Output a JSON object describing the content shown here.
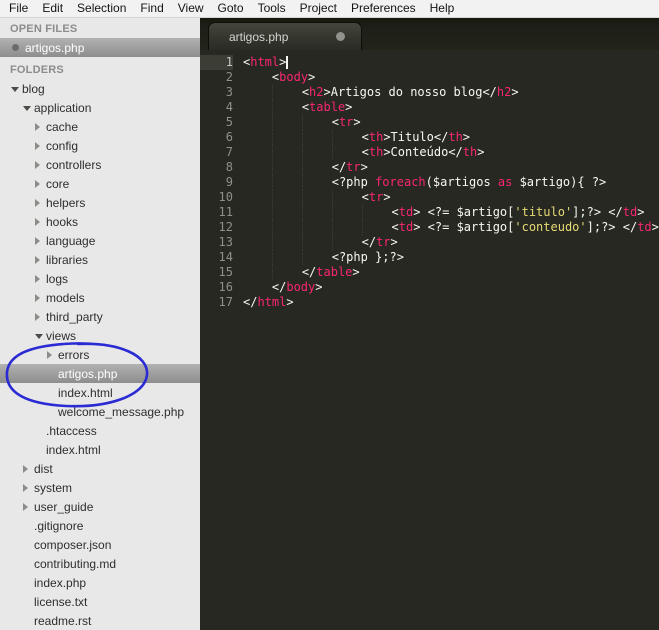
{
  "menu": {
    "items": [
      "File",
      "Edit",
      "Selection",
      "Find",
      "View",
      "Goto",
      "Tools",
      "Project",
      "Preferences",
      "Help"
    ]
  },
  "sidebar": {
    "open_files_header": "OPEN FILES",
    "open_files": [
      {
        "label": "artigos.php",
        "selected": true,
        "modified": true
      }
    ],
    "folders_header": "FOLDERS",
    "annotation": {
      "shape": "hand-drawn-ellipse",
      "color": "#2b2bd4",
      "around": [
        "views",
        "errors",
        "artigos.php"
      ]
    },
    "tree": [
      {
        "label": "blog",
        "type": "folder",
        "state": "expanded",
        "level": 0
      },
      {
        "label": "application",
        "type": "folder",
        "state": "expanded",
        "level": 1
      },
      {
        "label": "cache",
        "type": "folder",
        "state": "collapsed",
        "level": 2
      },
      {
        "label": "config",
        "type": "folder",
        "state": "collapsed",
        "level": 2
      },
      {
        "label": "controllers",
        "type": "folder",
        "state": "collapsed",
        "level": 2
      },
      {
        "label": "core",
        "type": "folder",
        "state": "collapsed",
        "level": 2
      },
      {
        "label": "helpers",
        "type": "folder",
        "state": "collapsed",
        "level": 2
      },
      {
        "label": "hooks",
        "type": "folder",
        "state": "collapsed",
        "level": 2
      },
      {
        "label": "language",
        "type": "folder",
        "state": "collapsed",
        "level": 2
      },
      {
        "label": "libraries",
        "type": "folder",
        "state": "collapsed",
        "level": 2
      },
      {
        "label": "logs",
        "type": "folder",
        "state": "collapsed",
        "level": 2
      },
      {
        "label": "models",
        "type": "folder",
        "state": "collapsed",
        "level": 2
      },
      {
        "label": "third_party",
        "type": "folder",
        "state": "collapsed",
        "level": 2
      },
      {
        "label": "views",
        "type": "folder",
        "state": "expanded",
        "level": 2
      },
      {
        "label": "errors",
        "type": "folder",
        "state": "collapsed",
        "level": 3
      },
      {
        "label": "artigos.php",
        "type": "file",
        "level": 3,
        "selected": true
      },
      {
        "label": "index.html",
        "type": "file",
        "level": 3
      },
      {
        "label": "welcome_message.php",
        "type": "file",
        "level": 3
      },
      {
        "label": ".htaccess",
        "type": "file",
        "level": 2
      },
      {
        "label": "index.html",
        "type": "file",
        "level": 2
      },
      {
        "label": "dist",
        "type": "folder",
        "state": "collapsed",
        "level": 1
      },
      {
        "label": "system",
        "type": "folder",
        "state": "collapsed",
        "level": 1
      },
      {
        "label": "user_guide",
        "type": "folder",
        "state": "collapsed",
        "level": 1
      },
      {
        "label": ".gitignore",
        "type": "file",
        "level": 1
      },
      {
        "label": "composer.json",
        "type": "file",
        "level": 1
      },
      {
        "label": "contributing.md",
        "type": "file",
        "level": 1
      },
      {
        "label": "index.php",
        "type": "file",
        "level": 1
      },
      {
        "label": "license.txt",
        "type": "file",
        "level": 1
      },
      {
        "label": "readme.rst",
        "type": "file",
        "level": 1
      }
    ]
  },
  "editor": {
    "tab": {
      "label": "artigos.php",
      "modified": true
    },
    "colors": {
      "bg": "#272822",
      "plain": "#f8f8f2",
      "tag": "#f92672",
      "string": "#e6db74",
      "line_number": "#8f908a"
    },
    "lines": [
      {
        "num": 1,
        "indent": 0,
        "cursor": true,
        "tokens": [
          [
            "p",
            "<"
          ],
          [
            "t",
            "html"
          ],
          [
            "p",
            ">"
          ]
        ]
      },
      {
        "num": 2,
        "indent": 4,
        "tokens": [
          [
            "p",
            "<"
          ],
          [
            "t",
            "body"
          ],
          [
            "p",
            ">"
          ]
        ]
      },
      {
        "num": 3,
        "indent": 8,
        "tokens": [
          [
            "p",
            "<"
          ],
          [
            "t",
            "h2"
          ],
          [
            "p",
            ">Artigos do nosso blog</"
          ],
          [
            "t",
            "h2"
          ],
          [
            "p",
            ">"
          ]
        ]
      },
      {
        "num": 4,
        "indent": 8,
        "tokens": [
          [
            "p",
            "<"
          ],
          [
            "t",
            "table"
          ],
          [
            "p",
            ">"
          ]
        ]
      },
      {
        "num": 5,
        "indent": 12,
        "tokens": [
          [
            "p",
            "<"
          ],
          [
            "t",
            "tr"
          ],
          [
            "p",
            ">"
          ]
        ]
      },
      {
        "num": 6,
        "indent": 16,
        "tokens": [
          [
            "p",
            "<"
          ],
          [
            "t",
            "th"
          ],
          [
            "p",
            ">Titulo</"
          ],
          [
            "t",
            "th"
          ],
          [
            "p",
            ">"
          ]
        ]
      },
      {
        "num": 7,
        "indent": 16,
        "tokens": [
          [
            "p",
            "<"
          ],
          [
            "t",
            "th"
          ],
          [
            "p",
            ">Conteúdo</"
          ],
          [
            "t",
            "th"
          ],
          [
            "p",
            ">"
          ]
        ]
      },
      {
        "num": 8,
        "indent": 12,
        "tokens": [
          [
            "p",
            "</"
          ],
          [
            "t",
            "tr"
          ],
          [
            "p",
            ">"
          ]
        ]
      },
      {
        "num": 9,
        "indent": 12,
        "tokens": [
          [
            "p",
            "<?php "
          ],
          [
            "t",
            "foreach"
          ],
          [
            "p",
            "($artigos "
          ],
          [
            "t",
            "as"
          ],
          [
            "p",
            " $artigo){ ?>"
          ]
        ]
      },
      {
        "num": 10,
        "indent": 16,
        "tokens": [
          [
            "p",
            "<"
          ],
          [
            "t",
            "tr"
          ],
          [
            "p",
            ">"
          ]
        ]
      },
      {
        "num": 11,
        "indent": 20,
        "tokens": [
          [
            "p",
            "<"
          ],
          [
            "t",
            "td"
          ],
          [
            "p",
            "> <?= $artigo["
          ],
          [
            "s",
            "'titulo'"
          ],
          [
            "p",
            "];?> </"
          ],
          [
            "t",
            "td"
          ],
          [
            "p",
            ">"
          ]
        ]
      },
      {
        "num": 12,
        "indent": 20,
        "tokens": [
          [
            "p",
            "<"
          ],
          [
            "t",
            "td"
          ],
          [
            "p",
            "> <?= $artigo["
          ],
          [
            "s",
            "'conteudo'"
          ],
          [
            "p",
            "];?> </"
          ],
          [
            "t",
            "td"
          ],
          [
            "p",
            ">"
          ]
        ]
      },
      {
        "num": 13,
        "indent": 16,
        "tokens": [
          [
            "p",
            "</"
          ],
          [
            "t",
            "tr"
          ],
          [
            "p",
            ">"
          ]
        ]
      },
      {
        "num": 14,
        "indent": 12,
        "tokens": [
          [
            "p",
            "<?php };?>"
          ]
        ]
      },
      {
        "num": 15,
        "indent": 8,
        "tokens": [
          [
            "p",
            "</"
          ],
          [
            "t",
            "table"
          ],
          [
            "p",
            ">"
          ]
        ]
      },
      {
        "num": 16,
        "indent": 4,
        "tokens": [
          [
            "p",
            "</"
          ],
          [
            "t",
            "body"
          ],
          [
            "p",
            ">"
          ]
        ]
      },
      {
        "num": 17,
        "indent": 0,
        "tokens": [
          [
            "p",
            "</"
          ],
          [
            "t",
            "html"
          ],
          [
            "p",
            ">"
          ]
        ]
      }
    ]
  }
}
